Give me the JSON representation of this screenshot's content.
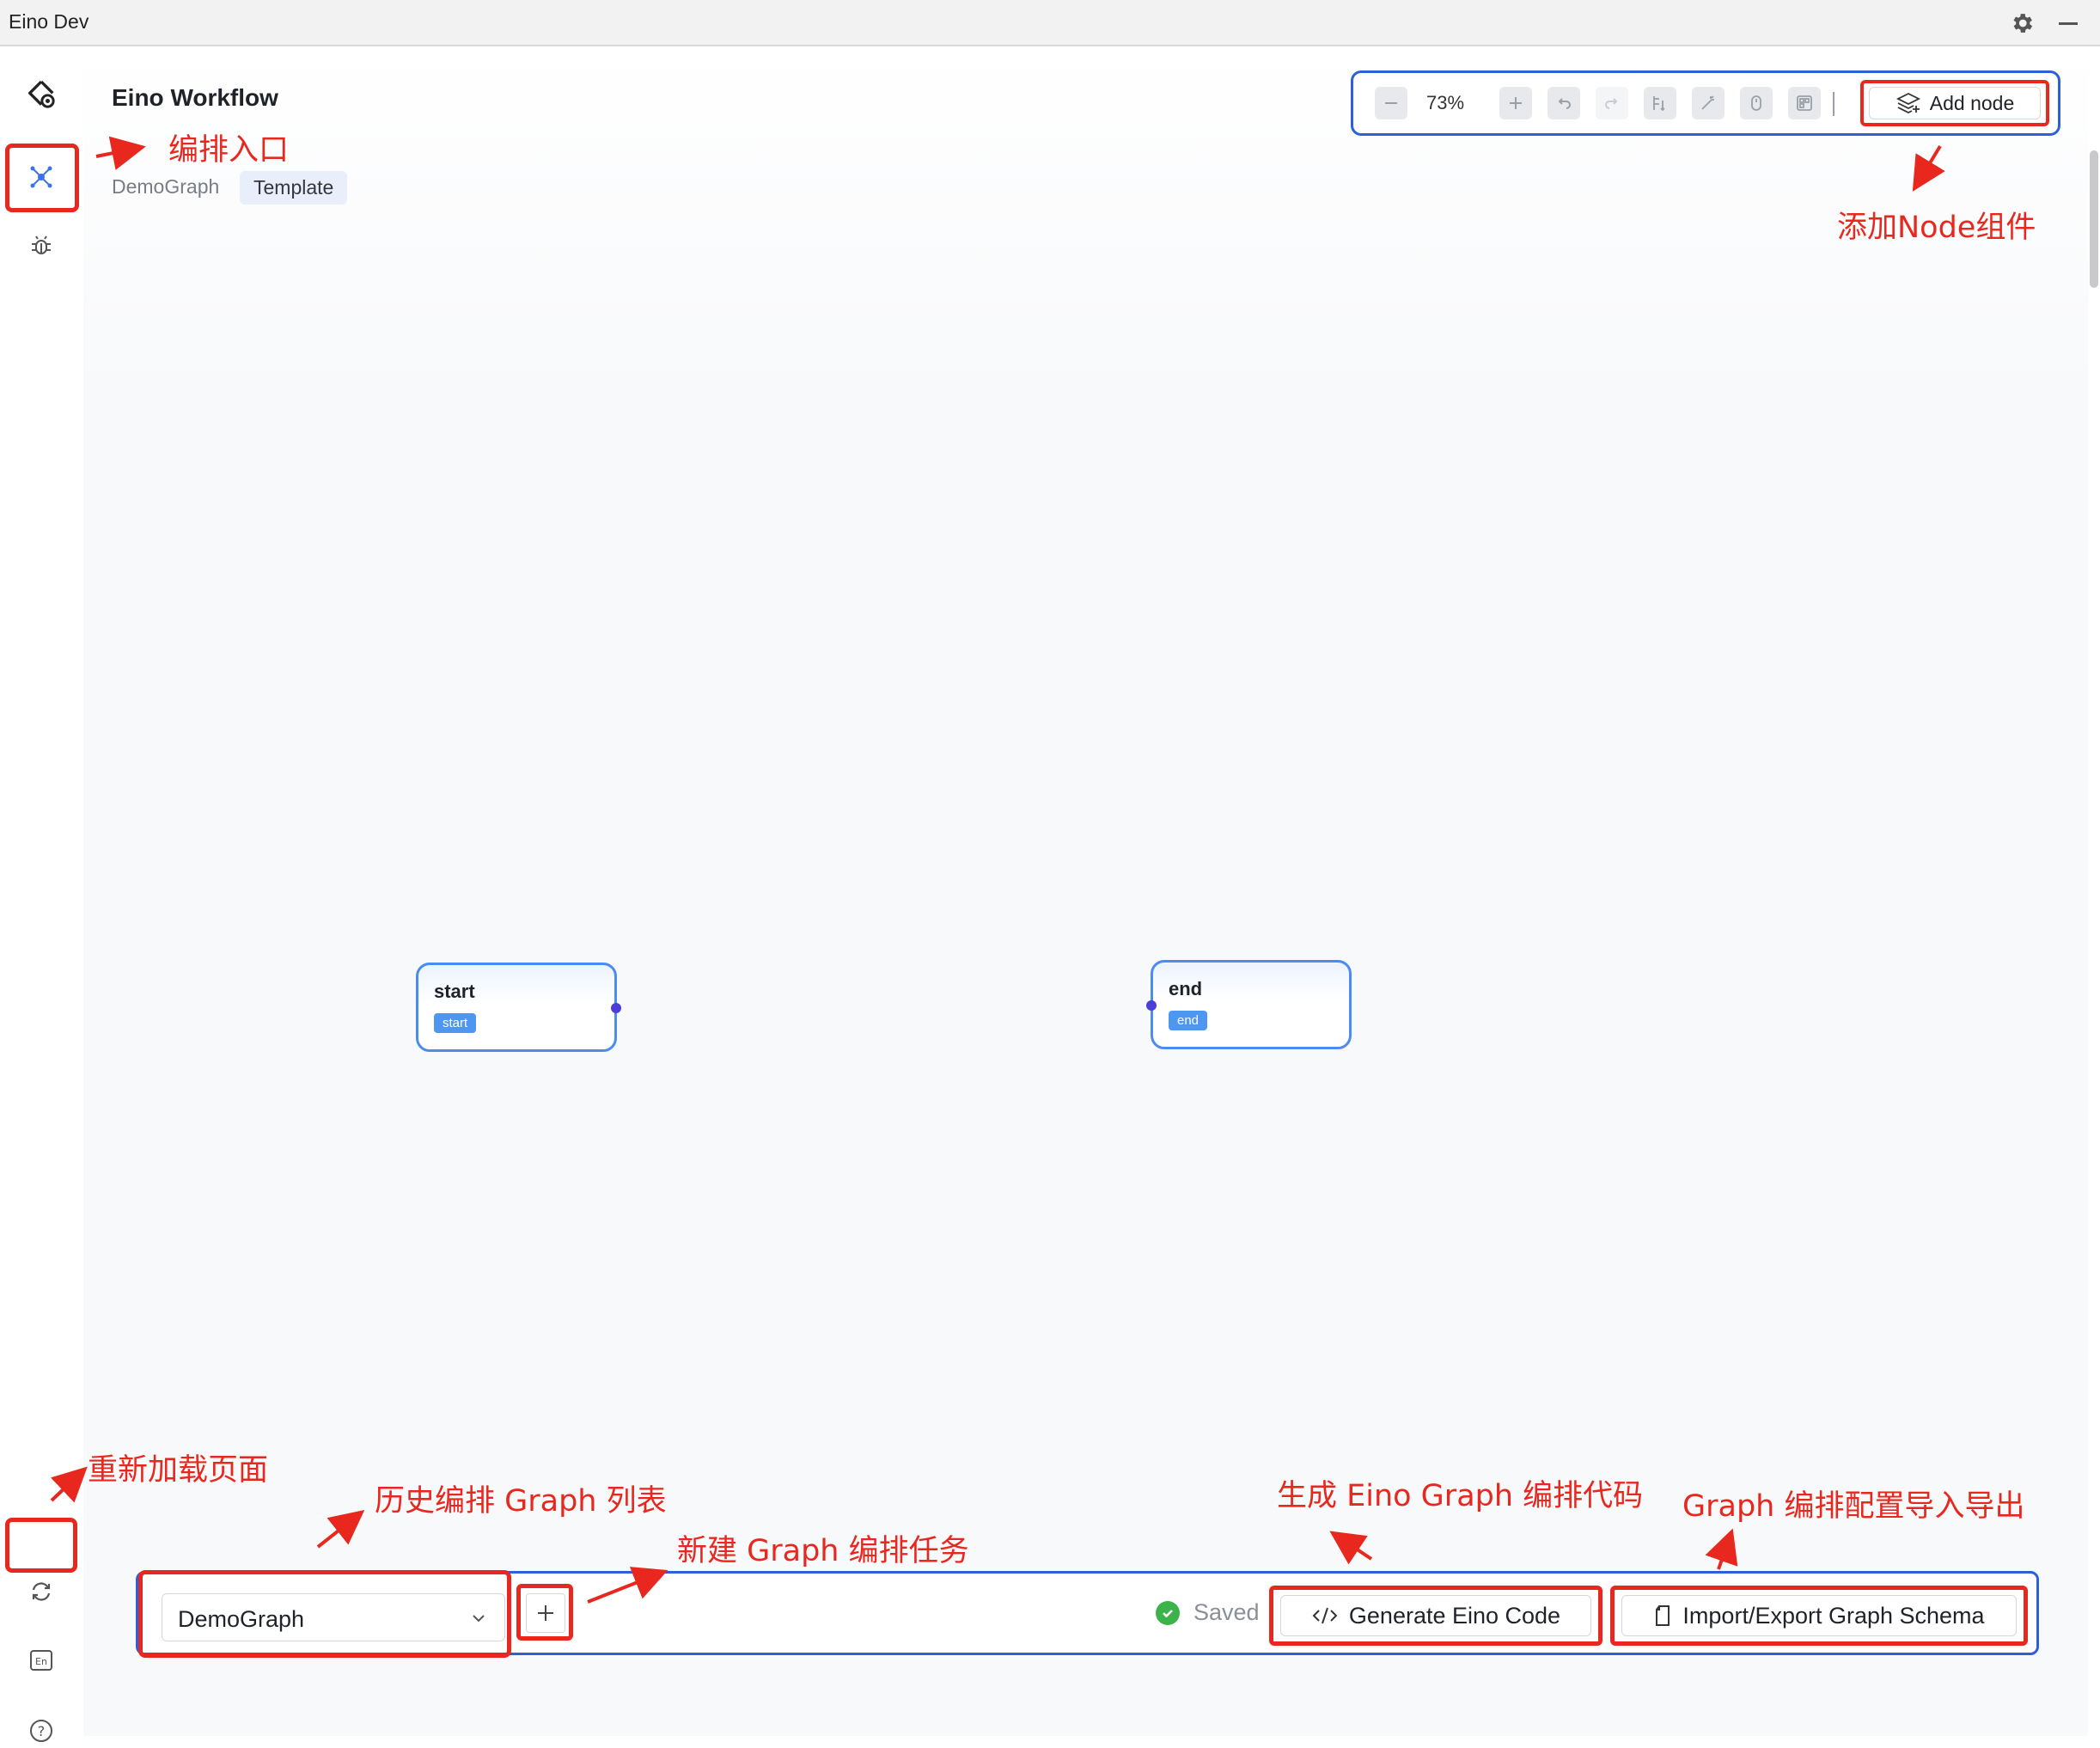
{
  "window": {
    "title": "Eino Dev"
  },
  "header": {
    "app_title": "Eino Workflow",
    "breadcrumb": {
      "graph_name": "DemoGraph",
      "tag": "Template"
    }
  },
  "toolbar": {
    "zoom": "73%",
    "add_node_label": "Add node"
  },
  "nodes": [
    {
      "name": "start",
      "tag": "start"
    },
    {
      "name": "end",
      "tag": "end"
    }
  ],
  "bottom_bar": {
    "graph_select_value": "DemoGraph",
    "saved_label": "Saved",
    "generate_label": "Generate Eino Code",
    "import_export_label": "Import/Export Graph Schema"
  },
  "annotations": {
    "orchestration_entry": "编排入口",
    "add_node_component": "添加Node组件",
    "reload_page": "重新加载页面",
    "history_graph_list": "历史编排 Graph 列表",
    "new_graph_task": "新建 Graph 编排任务",
    "generate_code": "生成 Eino Graph 编排代码",
    "import_export": "Graph 编排配置导入导出"
  },
  "colors": {
    "accent_blue": "#2d5fd6",
    "node_border": "#4a8cf0",
    "annotation_red": "#e8281e",
    "saved_green": "#3bb34a"
  },
  "icons": {
    "settings": "gear-icon",
    "minimize": "minimize-icon",
    "logo": "eino-logo-icon",
    "workflow": "workflow-icon",
    "debug": "bug-icon",
    "reload": "reload-icon",
    "language": "language-en-icon",
    "help": "help-icon"
  }
}
